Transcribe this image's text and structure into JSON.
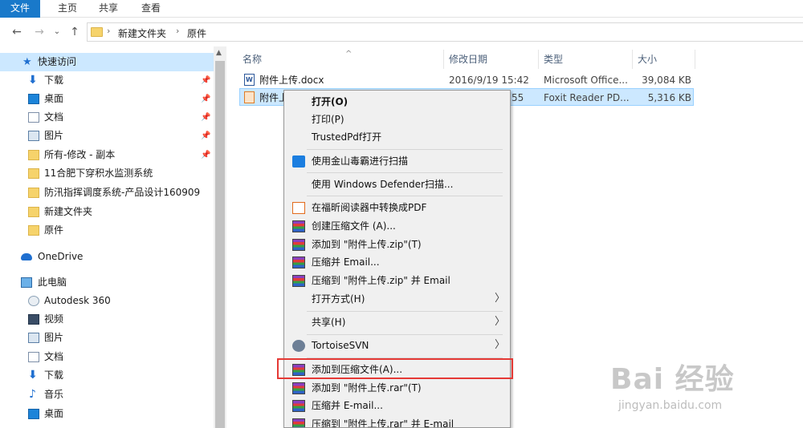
{
  "ribbon": {
    "tabs": [
      "文件",
      "主页",
      "共享",
      "查看"
    ]
  },
  "address": {
    "back_icon": "arrow-left-icon",
    "crumbs": [
      "新建文件夹",
      "原件"
    ],
    "separator": "›"
  },
  "nav": {
    "quick_access": "快速访问",
    "items": [
      {
        "label": "下载",
        "icon": "download-icon",
        "pinned": true
      },
      {
        "label": "桌面",
        "icon": "desktop-icon",
        "pinned": true
      },
      {
        "label": "文档",
        "icon": "document-icon",
        "pinned": true
      },
      {
        "label": "图片",
        "icon": "pictures-icon",
        "pinned": true
      },
      {
        "label": "所有-修改 - 副本",
        "icon": "folder-icon",
        "pinned": true
      },
      {
        "label": "11合肥下穿积水监测系统",
        "icon": "folder-icon",
        "pinned": false
      },
      {
        "label": "防汛指挥调度系统-产品设计160909",
        "icon": "folder-icon",
        "pinned": false
      },
      {
        "label": "新建文件夹",
        "icon": "folder-icon",
        "pinned": false
      },
      {
        "label": "原件",
        "icon": "folder-icon",
        "pinned": false
      }
    ],
    "onedrive": "OneDrive",
    "this_pc": "此电脑",
    "pc_items": [
      "Autodesk 360",
      "视频",
      "图片",
      "文档",
      "下载",
      "音乐",
      "桌面"
    ]
  },
  "columns": {
    "name": "名称",
    "date": "修改日期",
    "type": "类型",
    "size": "大小"
  },
  "files": [
    {
      "name": "附件上传.docx",
      "date": "2016/9/19 15:42",
      "type": "Microsoft Office...",
      "size": "39,084 KB"
    },
    {
      "name": "附件上",
      "date": "55",
      "type": "Foxit Reader PD...",
      "size": "5,316 KB"
    }
  ],
  "context_menu": {
    "open": "打开(O)",
    "print": "打印(P)",
    "trustedpdf": "TrustedPdf打开",
    "jinshan": "使用金山毒霸进行扫描",
    "defender": "使用 Windows Defender扫描...",
    "foxit_convert": "在福昕阅读器中转换成PDF",
    "create_zip": "创建压缩文件 (A)...",
    "add_zip": "添加到 \"附件上传.zip\"(T)",
    "zip_email": "压缩并 Email...",
    "zip_to_email": "压缩到 \"附件上传.zip\" 并 Email",
    "open_with": "打开方式(H)",
    "share": "共享(H)",
    "tortoise": "TortoiseSVN",
    "add_archive": "添加到压缩文件(A)...",
    "add_rar": "添加到 \"附件上传.rar\"(T)",
    "rar_email": "压缩并 E-mail...",
    "rar_to_email": "压缩到 \"附件上传.rar\" 并 E-mail"
  },
  "watermark": {
    "main": "Bai 经验",
    "sub": "jingyan.baidu.com"
  }
}
